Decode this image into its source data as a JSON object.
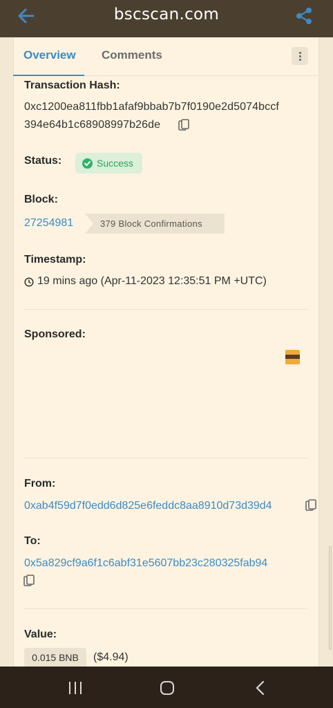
{
  "topbar": {
    "title": "bscscan.com",
    "back_icon": "arrow-left-icon",
    "share_icon": "share-icon"
  },
  "tabs": [
    {
      "label": "Overview",
      "active": true
    },
    {
      "label": "Comments",
      "active": false
    }
  ],
  "transaction": {
    "hash_label": "Transaction Hash:",
    "hash_line1": "0xc1200ea811fbb1afaf9bbab7b7f0190e2d5074bccf",
    "hash_line2": "394e64b1c68908997b26de",
    "status_label": "Status:",
    "status_value": "Success",
    "block_label": "Block:",
    "block_number": "27254981",
    "block_confirmations": "379 Block Confirmations",
    "timestamp_label": "Timestamp:",
    "timestamp_value": "19 mins ago (Apr-11-2023 12:35:51 PM +UTC)",
    "sponsored_label": "Sponsored:",
    "from_label": "From:",
    "from_address": "0xab4f59d7f0edd6d825e6feddc8aa8910d73d39d4",
    "to_label": "To:",
    "to_address": "0x5a829cf9a6f1c6abf31e5607bb23c280325fab94",
    "value_label": "Value:",
    "value_amount": "0.015 BNB",
    "value_usd": "($4.94)"
  },
  "colors": {
    "link": "#3d8bc4",
    "success": "#28a55f",
    "topbar": "#4b3f2f",
    "background": "#fdf3e0"
  },
  "navbar": {
    "recent_icon": "recent-apps-icon",
    "home_icon": "home-icon",
    "back_icon": "nav-back-icon"
  }
}
